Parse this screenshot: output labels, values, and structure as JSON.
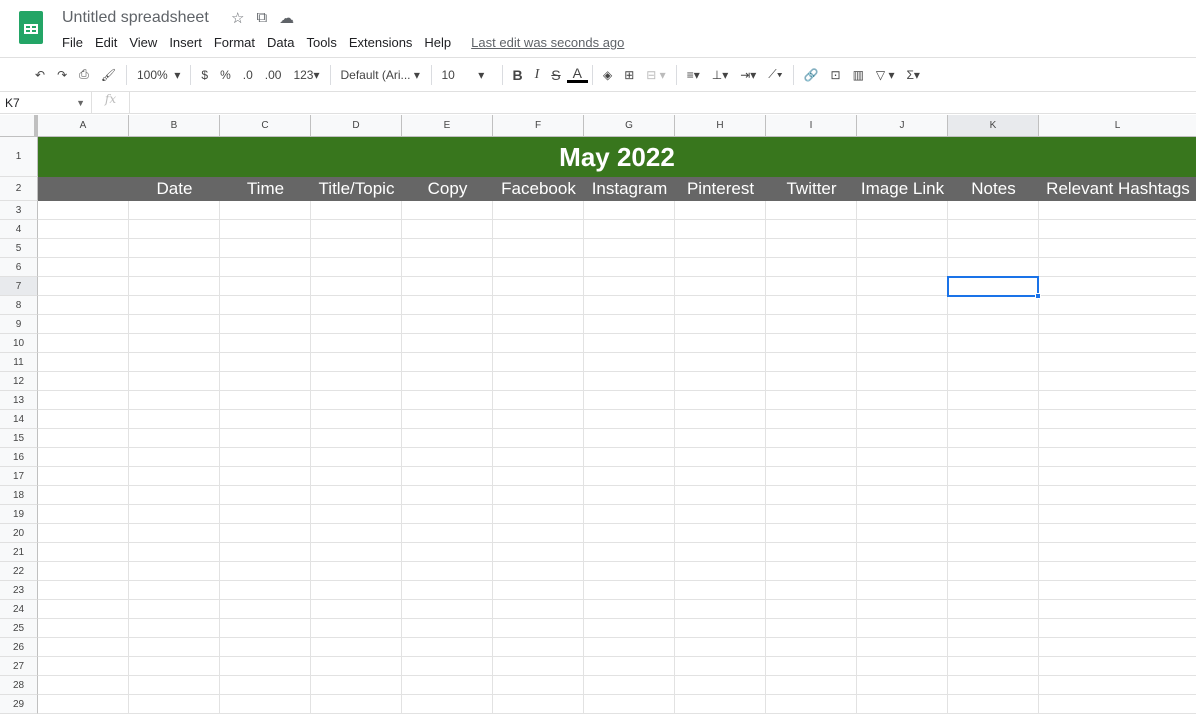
{
  "app": {
    "title": "Untitled spreadsheet",
    "icons": [
      "star-icon",
      "move-to-folder-icon",
      "cloud-saved-icon"
    ]
  },
  "menu": [
    "File",
    "Edit",
    "View",
    "Insert",
    "Format",
    "Data",
    "Tools",
    "Extensions",
    "Help"
  ],
  "last_edit": "Last edit was seconds ago",
  "toolbar": {
    "zoom": "100%",
    "currency": "$",
    "percent": "%",
    "dec_less": ".0",
    "dec_more": ".00",
    "format": "123",
    "font": "Default (Ari...",
    "size": "10",
    "bold": "B",
    "italic": "I",
    "strike": "S",
    "textcolor": "A"
  },
  "formula": {
    "cell_ref": "K7",
    "fx": "fx",
    "value": ""
  },
  "columns": [
    "A",
    "B",
    "C",
    "D",
    "E",
    "F",
    "G",
    "H",
    "I",
    "J",
    "K",
    "L"
  ],
  "selected": {
    "col": "K",
    "row": 7
  },
  "row1_title": "May 2022",
  "row1_color": "#38761d",
  "row2_headers": [
    "",
    "Date",
    "Time",
    "Title/Topic",
    "Copy",
    "Facebook",
    "Instagram",
    "Pinterest",
    "Twitter",
    "Image Link",
    "Notes",
    "Relevant Hashtags"
  ],
  "row2_color": "#666666",
  "row_count": 29
}
